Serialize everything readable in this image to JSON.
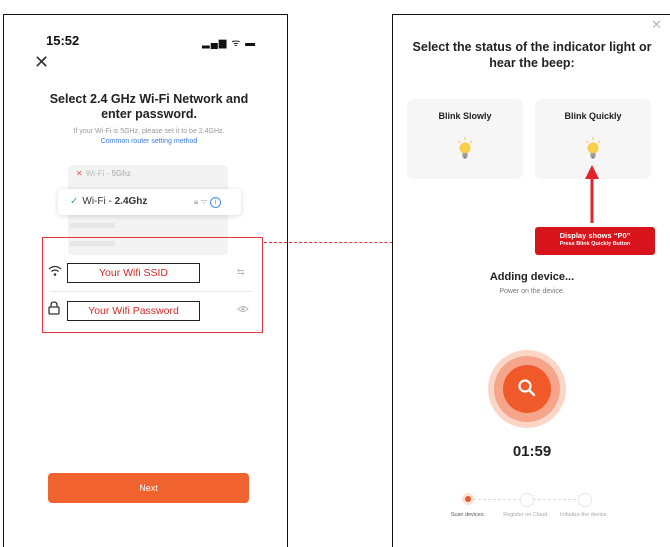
{
  "left_screen": {
    "status_time": "15:52",
    "status_icons": "▂▄▆ ᯤ ▬",
    "title": "Select 2.4 GHz Wi-Fi Network and enter password.",
    "hint": "If your Wi-Fi is 5GHz, please set it to be 2.4GHz.",
    "hint_link": "Common router setting method",
    "network_5g_prefix": "Wi-Fi - ",
    "network_5g_bold": "5Ghz",
    "network_24_prefix": "Wi-Fi - ",
    "network_24_bold": "2.4Ghz",
    "ssid_label": "Your Wifi SSID",
    "password_label": "Your Wifi Password",
    "next_button": "Next"
  },
  "right_screen": {
    "title": "Select the status of the indicator light or hear the beep:",
    "option_slow": "Blink Slowly",
    "option_quick": "Blink Quickly",
    "callout_line1": "Display shows “P0”",
    "callout_line2": "Press Blink Quickly Button",
    "adding_title": "Adding device...",
    "adding_subtitle": "Power on the device.",
    "countdown": "01:59",
    "steps": [
      {
        "label": "Scan devices."
      },
      {
        "label": "Register on Cloud."
      },
      {
        "label": "Initialize the device."
      }
    ]
  },
  "colors": {
    "accent_orange": "#f05a2a",
    "annotation_red": "#d7141c",
    "link_blue": "#3b7be0",
    "check_green": "#2fb36b"
  },
  "icons": {
    "close": "close-icon",
    "check": "check-icon",
    "wifi": "wifi-icon",
    "lock": "lock-icon",
    "eye": "eye-icon",
    "bulb": "light-bulb-icon",
    "search": "search-icon"
  }
}
